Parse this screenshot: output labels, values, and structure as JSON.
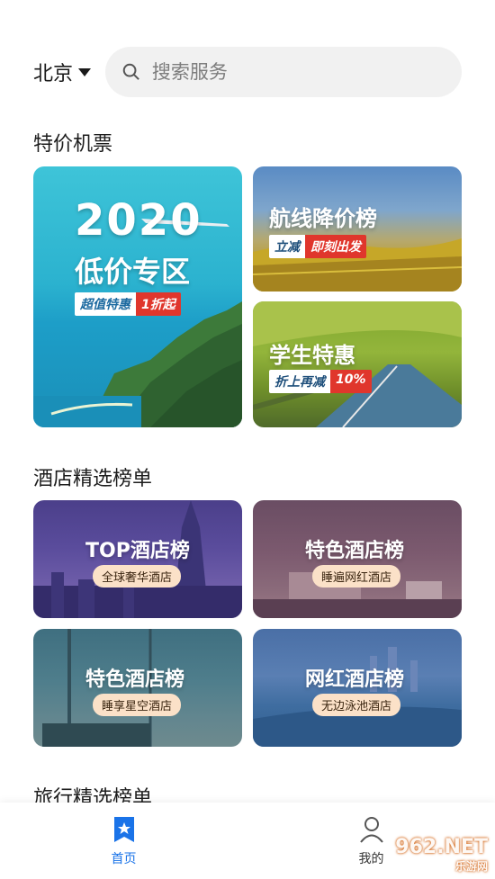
{
  "header": {
    "city": "北京",
    "search_placeholder": "搜索服务"
  },
  "sections": {
    "flights": "特价机票",
    "hotels": "酒店精选榜单",
    "travel": "旅行精选榜单"
  },
  "flight_cards": {
    "big": {
      "year": "2020",
      "title": "低价专区",
      "tag_a": "超值特惠",
      "tag_b": "1折起"
    },
    "route": {
      "title": "航线降价榜",
      "tag_a": "立减",
      "tag_b": "即刻出发"
    },
    "student": {
      "title": "学生特惠",
      "tag_a": "折上再减",
      "tag_b": "10%"
    }
  },
  "hotel_cards": [
    {
      "title": "TOP酒店榜",
      "pill": "全球奢华酒店"
    },
    {
      "title": "特色酒店榜",
      "pill": "睡遍网红酒店"
    },
    {
      "title": "特色酒店榜",
      "pill": "睡享星空酒店"
    },
    {
      "title": "网红酒店榜",
      "pill": "无边泳池酒店"
    }
  ],
  "nav": {
    "home": "首页",
    "mine": "我的"
  },
  "colors": {
    "accent": "#1a73e8"
  },
  "watermark": {
    "main": "962.NET",
    "sub": "乐游网"
  }
}
